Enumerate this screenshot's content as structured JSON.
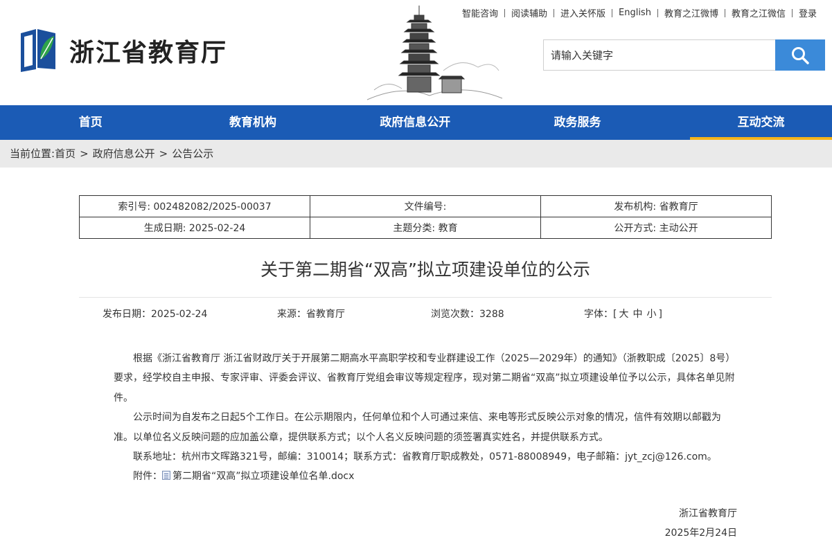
{
  "header": {
    "top_links": [
      "智能咨询",
      "阅读辅助",
      "进入关怀版",
      "English",
      "教育之江微博",
      "教育之江微信",
      "登录"
    ],
    "site_title": "浙江省教育厅",
    "search": {
      "placeholder": "请输入关键字"
    },
    "icons": {
      "logo": "zhejiang-education-logo",
      "banner": "pagoda-illustration",
      "search": "search-icon"
    }
  },
  "nav": {
    "items": [
      "首页",
      "教育机构",
      "政府信息公开",
      "政务服务",
      "互动交流"
    ],
    "active": "互动交流"
  },
  "breadcrumb": {
    "prefix": "当前位置:",
    "items": [
      "首页",
      "政府信息公开",
      "公告公示"
    ],
    "separator": ">"
  },
  "meta": {
    "index_no": "索引号: 002482082/2025-00037",
    "doc_no": "文件编号:",
    "publisher": "发布机构: 省教育厅",
    "created_date": "生成日期: 2025-02-24",
    "category": "主题分类: 教育",
    "disclosure": "公开方式: 主动公开"
  },
  "article": {
    "title": "关于第二期省“双高”拟立项建设单位的公示",
    "publish_date": "发布日期：2025-02-24",
    "source": "来源：省教育厅",
    "views": "浏览次数：3288",
    "font_label": "字体：[",
    "font_large": "大",
    "font_medium": "中",
    "font_small": "小",
    "font_close": "]",
    "paragraphs": [
      "根据《浙江省教育厅 浙江省财政厅关于开展第二期高水平高职学校和专业群建设工作（2025—2029年）的通知》（浙教职成〔2025〕8号）要求，经学校自主申报、专家评审、评委会评议、省教育厅党组会审议等规定程序，现对第二期省“双高”拟立项建设单位予以公示，具体名单见附件。",
      "公示时间为自发布之日起5个工作日。在公示期限内，任何单位和个人可通过来信、来电等形式反映公示对象的情况，信件有效期以邮戳为准。以单位名义反映问题的应加盖公章，提供联系方式；以个人名义反映问题的须签署真实姓名，并提供联系方式。",
      "联系地址：杭州市文晖路321号，邮编：310014；联系方式：省教育厅职成教处，0571-88008949，电子邮箱：jyt_zcj@126.com。"
    ],
    "attachment_label": "附件：",
    "attachment_name": "第二期省“双高”拟立项建设单位名单.docx",
    "signature_org": "浙江省教育厅",
    "signature_date": "2025年2月24日"
  },
  "colors": {
    "nav_bg": "#1b5bb5",
    "nav_active_underline": "#f4b41a",
    "search_button": "#3b8ad9",
    "breadcrumb_bg": "#eaeaea"
  }
}
